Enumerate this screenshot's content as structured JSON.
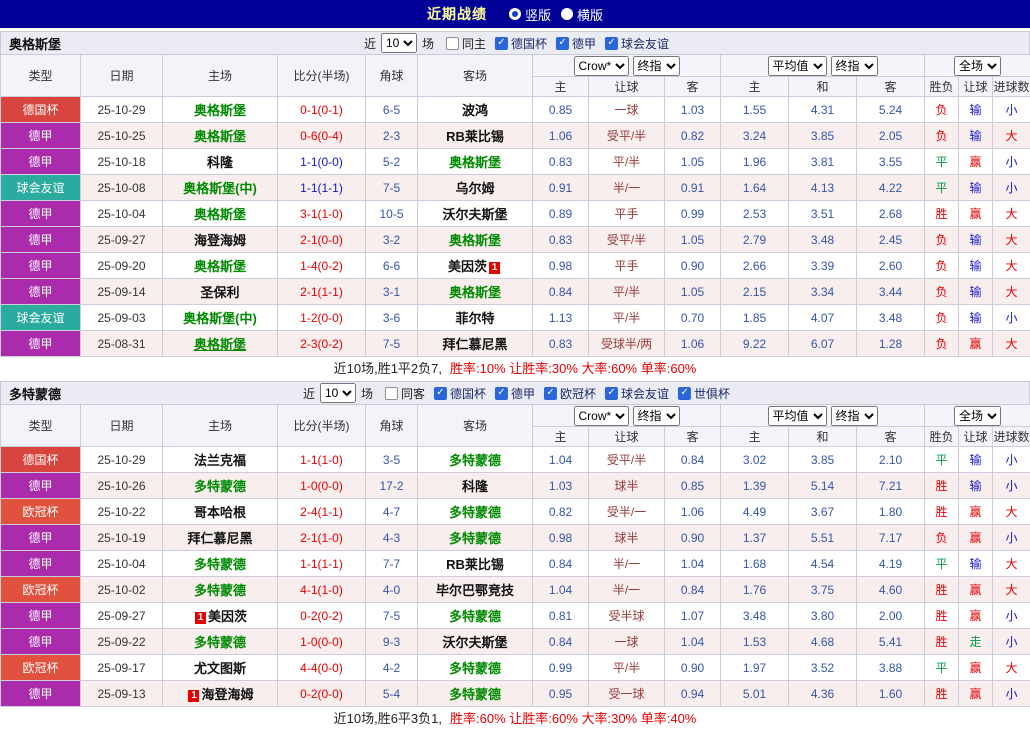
{
  "topbar": {
    "title": "近期战绩",
    "radios": [
      {
        "label": "竖版",
        "selected": true
      },
      {
        "label": "横版",
        "selected": false
      }
    ]
  },
  "header": {
    "col_type": "类型",
    "col_date": "日期",
    "col_home": "主场",
    "col_score": "比分(半场)",
    "col_corner": "角球",
    "col_away": "客场",
    "odds_select": "Crow*",
    "final_select": "终指",
    "avg_select": "平均值",
    "full_select": "全场",
    "sub_home": "主",
    "sub_handicap": "让球",
    "sub_away": "客",
    "sub_draw": "和",
    "sub_winloss": "胜负",
    "sub_goals": "进球数"
  },
  "colors": {
    "league": {
      "德国杯": "#d8453e",
      "德甲": "#aa2cac",
      "球会友谊": "#2bab9f",
      "欧冠杯": "#e0523e"
    },
    "result_red": "#e60000",
    "result_blue": "#1717c9",
    "result_green": "#009944",
    "focus_team_green": "#008a00",
    "topbar_navy": "#000097"
  },
  "sections": [
    {
      "team": "奥格斯堡",
      "filter": {
        "prefix": "近",
        "count": "10",
        "suffix": "场",
        "same_label": "同主",
        "same_checked": false,
        "leagues": [
          {
            "label": "德国杯",
            "checked": true
          },
          {
            "label": "德甲",
            "checked": true
          },
          {
            "label": "球会友谊",
            "checked": true
          }
        ]
      },
      "rows": [
        {
          "type": "德国杯",
          "date": "25-10-29",
          "home": {
            "text": "奥格斯堡",
            "focus": true
          },
          "score": "0-1(0-1)",
          "score_color": "red",
          "corner": "6-5",
          "away": {
            "text": "波鸿",
            "focus": false
          },
          "odds": [
            "0.85",
            "一球",
            "1.03"
          ],
          "avg": [
            "1.55",
            "4.31",
            "5.24"
          ],
          "results": [
            {
              "t": "负",
              "c": "red"
            },
            {
              "t": "输",
              "c": "blue"
            },
            {
              "t": "小",
              "c": "blue"
            }
          ]
        },
        {
          "type": "德甲",
          "date": "25-10-25",
          "home": {
            "text": "奥格斯堡",
            "focus": true
          },
          "score": "0-6(0-4)",
          "score_color": "red",
          "corner": "2-3",
          "away": {
            "text": "RB莱比锡",
            "focus": false
          },
          "odds": [
            "1.06",
            "受平/半",
            "0.82"
          ],
          "avg": [
            "3.24",
            "3.85",
            "2.05"
          ],
          "results": [
            {
              "t": "负",
              "c": "red"
            },
            {
              "t": "输",
              "c": "blue"
            },
            {
              "t": "大",
              "c": "red"
            }
          ]
        },
        {
          "type": "德甲",
          "date": "25-10-18",
          "home": {
            "text": "科隆",
            "focus": false
          },
          "score": "1-1(0-0)",
          "score_color": "blue",
          "corner": "5-2",
          "away": {
            "text": "奥格斯堡",
            "focus": true
          },
          "odds": [
            "0.83",
            "平/半",
            "1.05"
          ],
          "avg": [
            "1.96",
            "3.81",
            "3.55"
          ],
          "results": [
            {
              "t": "平",
              "c": "green"
            },
            {
              "t": "赢",
              "c": "red"
            },
            {
              "t": "小",
              "c": "blue"
            }
          ]
        },
        {
          "type": "球会友谊",
          "date": "25-10-08",
          "home": {
            "text": "奥格斯堡(中)",
            "focus": true
          },
          "score": "1-1(1-1)",
          "score_color": "blue",
          "corner": "7-5",
          "away": {
            "text": "乌尔姆",
            "focus": false
          },
          "odds": [
            "0.91",
            "半/一",
            "0.91"
          ],
          "avg": [
            "1.64",
            "4.13",
            "4.22"
          ],
          "results": [
            {
              "t": "平",
              "c": "green"
            },
            {
              "t": "输",
              "c": "blue"
            },
            {
              "t": "小",
              "c": "blue"
            }
          ]
        },
        {
          "type": "德甲",
          "date": "25-10-04",
          "home": {
            "text": "奥格斯堡",
            "focus": true
          },
          "score": "3-1(1-0)",
          "score_color": "red",
          "corner": "10-5",
          "away": {
            "text": "沃尔夫斯堡",
            "focus": false
          },
          "odds": [
            "0.89",
            "平手",
            "0.99"
          ],
          "avg": [
            "2.53",
            "3.51",
            "2.68"
          ],
          "results": [
            {
              "t": "胜",
              "c": "red"
            },
            {
              "t": "赢",
              "c": "red"
            },
            {
              "t": "大",
              "c": "red"
            }
          ]
        },
        {
          "type": "德甲",
          "date": "25-09-27",
          "home": {
            "text": "海登海姆",
            "focus": false
          },
          "score": "2-1(0-0)",
          "score_color": "red",
          "corner": "3-2",
          "away": {
            "text": "奥格斯堡",
            "focus": true
          },
          "odds": [
            "0.83",
            "受平/半",
            "1.05"
          ],
          "avg": [
            "2.79",
            "3.48",
            "2.45"
          ],
          "results": [
            {
              "t": "负",
              "c": "red"
            },
            {
              "t": "输",
              "c": "blue"
            },
            {
              "t": "大",
              "c": "red"
            }
          ]
        },
        {
          "type": "德甲",
          "date": "25-09-20",
          "home": {
            "text": "奥格斯堡",
            "focus": true
          },
          "score": "1-4(0-2)",
          "score_color": "red",
          "corner": "6-6",
          "away": {
            "text": "美因茨",
            "focus": false,
            "badge_after": "1"
          },
          "odds": [
            "0.98",
            "平手",
            "0.90"
          ],
          "avg": [
            "2.66",
            "3.39",
            "2.60"
          ],
          "results": [
            {
              "t": "负",
              "c": "red"
            },
            {
              "t": "输",
              "c": "blue"
            },
            {
              "t": "大",
              "c": "red"
            }
          ]
        },
        {
          "type": "德甲",
          "date": "25-09-14",
          "home": {
            "text": "圣保利",
            "focus": false
          },
          "score": "2-1(1-1)",
          "score_color": "red",
          "corner": "3-1",
          "away": {
            "text": "奥格斯堡",
            "focus": true
          },
          "odds": [
            "0.84",
            "平/半",
            "1.05"
          ],
          "avg": [
            "2.15",
            "3.34",
            "3.44"
          ],
          "results": [
            {
              "t": "负",
              "c": "red"
            },
            {
              "t": "输",
              "c": "blue"
            },
            {
              "t": "大",
              "c": "red"
            }
          ]
        },
        {
          "type": "球会友谊",
          "date": "25-09-03",
          "home": {
            "text": "奥格斯堡(中)",
            "focus": true
          },
          "score": "1-2(0-0)",
          "score_color": "red",
          "corner": "3-6",
          "away": {
            "text": "菲尔特",
            "focus": false
          },
          "odds": [
            "1.13",
            "平/半",
            "0.70"
          ],
          "avg": [
            "1.85",
            "4.07",
            "3.48"
          ],
          "results": [
            {
              "t": "负",
              "c": "red"
            },
            {
              "t": "输",
              "c": "blue"
            },
            {
              "t": "小",
              "c": "blue"
            }
          ]
        },
        {
          "type": "德甲",
          "date": "25-08-31",
          "home": {
            "text": "奥格斯堡",
            "focus": true,
            "underline": true
          },
          "score": "2-3(0-2)",
          "score_color": "red",
          "corner": "7-5",
          "away": {
            "text": "拜仁慕尼黑",
            "focus": false
          },
          "odds": [
            "0.83",
            "受球半/两",
            "1.06"
          ],
          "avg": [
            "9.22",
            "6.07",
            "1.28"
          ],
          "results": [
            {
              "t": "负",
              "c": "red"
            },
            {
              "t": "赢",
              "c": "red"
            },
            {
              "t": "大",
              "c": "red"
            }
          ]
        }
      ],
      "summary": {
        "prefix": "近10场,胜1平2负7,",
        "stats": "胜率:10% 让胜率:30% 大率:60% 单率:60%"
      }
    },
    {
      "team": "多特蒙德",
      "filter": {
        "prefix": "近",
        "count": "10",
        "suffix": "场",
        "same_label": "同客",
        "same_checked": false,
        "leagues": [
          {
            "label": "德国杯",
            "checked": true
          },
          {
            "label": "德甲",
            "checked": true
          },
          {
            "label": "欧冠杯",
            "checked": true
          },
          {
            "label": "球会友谊",
            "checked": true
          },
          {
            "label": "世俱杯",
            "checked": true
          }
        ]
      },
      "rows": [
        {
          "type": "德国杯",
          "date": "25-10-29",
          "home": {
            "text": "法兰克福",
            "focus": false
          },
          "score": "1-1(1-0)",
          "score_color": "red",
          "corner": "3-5",
          "away": {
            "text": "多特蒙德",
            "focus": true
          },
          "odds": [
            "1.04",
            "受平/半",
            "0.84"
          ],
          "avg": [
            "3.02",
            "3.85",
            "2.10"
          ],
          "results": [
            {
              "t": "平",
              "c": "green"
            },
            {
              "t": "输",
              "c": "blue"
            },
            {
              "t": "小",
              "c": "blue"
            }
          ]
        },
        {
          "type": "德甲",
          "date": "25-10-26",
          "home": {
            "text": "多特蒙德",
            "focus": true
          },
          "score": "1-0(0-0)",
          "score_color": "red",
          "corner": "17-2",
          "away": {
            "text": "科隆",
            "focus": false
          },
          "odds": [
            "1.03",
            "球半",
            "0.85"
          ],
          "avg": [
            "1.39",
            "5.14",
            "7.21"
          ],
          "results": [
            {
              "t": "胜",
              "c": "red"
            },
            {
              "t": "输",
              "c": "blue"
            },
            {
              "t": "小",
              "c": "blue"
            }
          ]
        },
        {
          "type": "欧冠杯",
          "date": "25-10-22",
          "home": {
            "text": "哥本哈根",
            "focus": false
          },
          "score": "2-4(1-1)",
          "score_color": "red",
          "corner": "4-7",
          "away": {
            "text": "多特蒙德",
            "focus": true
          },
          "odds": [
            "0.82",
            "受半/一",
            "1.06"
          ],
          "avg": [
            "4.49",
            "3.67",
            "1.80"
          ],
          "results": [
            {
              "t": "胜",
              "c": "red"
            },
            {
              "t": "赢",
              "c": "red"
            },
            {
              "t": "大",
              "c": "red"
            }
          ]
        },
        {
          "type": "德甲",
          "date": "25-10-19",
          "home": {
            "text": "拜仁慕尼黑",
            "focus": false
          },
          "score": "2-1(1-0)",
          "score_color": "red",
          "corner": "4-3",
          "away": {
            "text": "多特蒙德",
            "focus": true
          },
          "odds": [
            "0.98",
            "球半",
            "0.90"
          ],
          "avg": [
            "1.37",
            "5.51",
            "7.17"
          ],
          "results": [
            {
              "t": "负",
              "c": "red"
            },
            {
              "t": "赢",
              "c": "red"
            },
            {
              "t": "小",
              "c": "blue"
            }
          ]
        },
        {
          "type": "德甲",
          "date": "25-10-04",
          "home": {
            "text": "多特蒙德",
            "focus": true
          },
          "score": "1-1(1-1)",
          "score_color": "red",
          "corner": "7-7",
          "away": {
            "text": "RB莱比锡",
            "focus": false
          },
          "odds": [
            "0.84",
            "半/一",
            "1.04"
          ],
          "avg": [
            "1.68",
            "4.54",
            "4.19"
          ],
          "results": [
            {
              "t": "平",
              "c": "green"
            },
            {
              "t": "输",
              "c": "blue"
            },
            {
              "t": "大",
              "c": "red"
            }
          ]
        },
        {
          "type": "欧冠杯",
          "date": "25-10-02",
          "home": {
            "text": "多特蒙德",
            "focus": true
          },
          "score": "4-1(1-0)",
          "score_color": "red",
          "corner": "4-0",
          "away": {
            "text": "毕尔巴鄂竞技",
            "focus": false
          },
          "odds": [
            "1.04",
            "半/一",
            "0.84"
          ],
          "avg": [
            "1.76",
            "3.75",
            "4.60"
          ],
          "results": [
            {
              "t": "胜",
              "c": "red"
            },
            {
              "t": "赢",
              "c": "red"
            },
            {
              "t": "大",
              "c": "red"
            }
          ]
        },
        {
          "type": "德甲",
          "date": "25-09-27",
          "home": {
            "text": "美因茨",
            "focus": false,
            "badge": "1"
          },
          "score": "0-2(0-2)",
          "score_color": "red",
          "corner": "7-5",
          "away": {
            "text": "多特蒙德",
            "focus": true
          },
          "odds": [
            "0.81",
            "受半球",
            "1.07"
          ],
          "avg": [
            "3.48",
            "3.80",
            "2.00"
          ],
          "results": [
            {
              "t": "胜",
              "c": "red"
            },
            {
              "t": "赢",
              "c": "red"
            },
            {
              "t": "小",
              "c": "blue"
            }
          ]
        },
        {
          "type": "德甲",
          "date": "25-09-22",
          "home": {
            "text": "多特蒙德",
            "focus": true
          },
          "score": "1-0(0-0)",
          "score_color": "red",
          "corner": "9-3",
          "away": {
            "text": "沃尔夫斯堡",
            "focus": false
          },
          "odds": [
            "0.84",
            "一球",
            "1.04"
          ],
          "avg": [
            "1.53",
            "4.68",
            "5.41"
          ],
          "results": [
            {
              "t": "胜",
              "c": "red"
            },
            {
              "t": "走",
              "c": "green"
            },
            {
              "t": "小",
              "c": "blue"
            }
          ]
        },
        {
          "type": "欧冠杯",
          "date": "25-09-17",
          "home": {
            "text": "尤文图斯",
            "focus": false
          },
          "score": "4-4(0-0)",
          "score_color": "red",
          "corner": "4-2",
          "away": {
            "text": "多特蒙德",
            "focus": true
          },
          "odds": [
            "0.99",
            "平/半",
            "0.90"
          ],
          "avg": [
            "1.97",
            "3.52",
            "3.88"
          ],
          "results": [
            {
              "t": "平",
              "c": "green"
            },
            {
              "t": "赢",
              "c": "red"
            },
            {
              "t": "大",
              "c": "red"
            }
          ]
        },
        {
          "type": "德甲",
          "date": "25-09-13",
          "home": {
            "text": "海登海姆",
            "focus": false,
            "badge": "1"
          },
          "score": "0-2(0-0)",
          "score_color": "red",
          "corner": "5-4",
          "away": {
            "text": "多特蒙德",
            "focus": true
          },
          "odds": [
            "0.95",
            "受一球",
            "0.94"
          ],
          "avg": [
            "5.01",
            "4.36",
            "1.60"
          ],
          "results": [
            {
              "t": "胜",
              "c": "red"
            },
            {
              "t": "赢",
              "c": "red"
            },
            {
              "t": "小",
              "c": "blue"
            }
          ]
        }
      ],
      "summary": {
        "prefix": "近10场,胜6平3负1,",
        "stats": "胜率:60% 让胜率:60% 大率:30% 单率:40%"
      }
    }
  ]
}
